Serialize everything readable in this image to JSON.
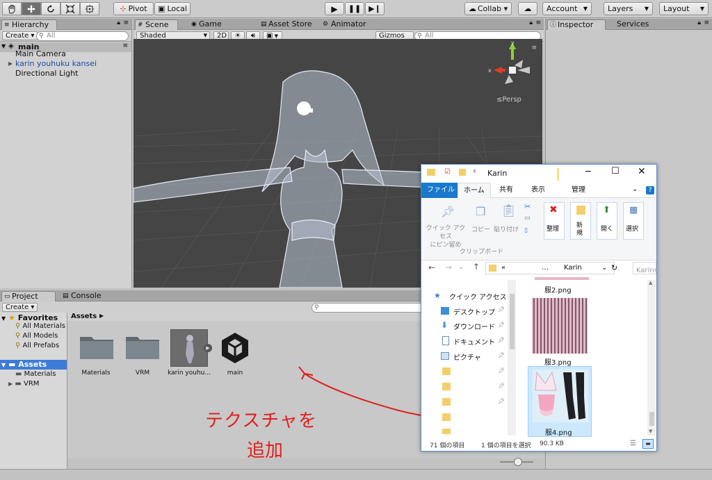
{
  "toolbar": {
    "pivot": "Pivot",
    "local": "Local",
    "collab": "Collab ▾",
    "account": "Account",
    "layers": "Layers",
    "layout": "Layout"
  },
  "hierarchy": {
    "tab": "Hierarchy",
    "create": "Create ▾",
    "search_placeholder": "All",
    "scene_name": "main",
    "items": [
      "Main Camera",
      "karin youhuku kansei",
      "Directional Light"
    ]
  },
  "scene": {
    "tabs": [
      "Scene",
      "Game",
      "Asset Store",
      "Animator"
    ],
    "shading": "Shaded",
    "mode_2d": "2D",
    "gizmos": "Gizmos ▾",
    "search_placeholder": "All",
    "persp": "≤Persp"
  },
  "inspector": {
    "tabs": [
      "Inspector",
      "Services"
    ]
  },
  "project": {
    "tabs": [
      "Project",
      "Console"
    ],
    "create": "Create ▾",
    "favorites": "Favorites",
    "favorites_items": [
      "All Materials",
      "All Models",
      "All Prefabs"
    ],
    "assets_root": "Assets",
    "assets_children": [
      "Materials",
      "VRM"
    ],
    "breadcrumb": "Assets",
    "assets": [
      "Materials",
      "VRM",
      "karin youhu...",
      "main"
    ]
  },
  "annotation": {
    "line1": "テクスチャを",
    "line2": "追加",
    "color": "#e0201c"
  },
  "explorer": {
    "title": "Karin",
    "ribbon_tabs": [
      "ファイル",
      "ホーム",
      "共有",
      "表示",
      "管理"
    ],
    "ribbon": {
      "pin": "クイック アクセス\nにピン留め",
      "copy": "コピー",
      "paste": "貼り付け",
      "clipboard_group": "クリップボード",
      "organize": "整理",
      "new": "新\n規",
      "open": "開く",
      "select": "選択"
    },
    "address": [
      "«",
      "…",
      "Karin"
    ],
    "search_placeholder": "Karinの",
    "nav": [
      "クイック アクセス",
      "デスクトップ",
      "ダウンロード",
      "ドキュメント",
      "ピクチャ"
    ],
    "files": [
      "服2.png",
      "服3.png",
      "服4.png"
    ],
    "status": {
      "count": "71 個の項目",
      "selected": "1 個の項目を選択",
      "size": "90.3 KB"
    }
  }
}
